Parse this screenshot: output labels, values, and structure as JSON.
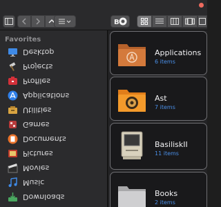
{
  "window": {
    "traffic_lights": [
      "#ec6a5e",
      "#f4bf4f",
      "#61c554"
    ],
    "accent": "#4a8fe8"
  },
  "toolbar": {
    "back_icon": "chevron-left-icon",
    "forward_icon": "chevron-right-icon",
    "up_icon": "chevron-up-icon",
    "action_icon": "list-action-icon",
    "tag_button_label": "B",
    "views": [
      "icon-view",
      "list-view",
      "column-view",
      "gallery-view"
    ],
    "selected_view": "icon-view"
  },
  "sidebar": {
    "header": "Favorites",
    "items": [
      {
        "label": "Desktop",
        "icon": "desktop-icon"
      },
      {
        "label": "Projects",
        "icon": "projects-icon"
      },
      {
        "label": "Profiles",
        "icon": "profiles-icon"
      },
      {
        "label": "Applications",
        "icon": "applications-icon"
      },
      {
        "label": "Utilities",
        "icon": "utilities-icon"
      },
      {
        "label": "Games",
        "icon": "games-icon"
      },
      {
        "label": "Documents",
        "icon": "documents-icon"
      },
      {
        "label": "Pictures",
        "icon": "pictures-icon"
      },
      {
        "label": "Movies",
        "icon": "movies-icon"
      },
      {
        "label": "Music",
        "icon": "music-icon"
      },
      {
        "label": "Downloads",
        "icon": "downloads-icon"
      }
    ]
  },
  "folders": [
    {
      "name": "Applications",
      "count": "6 items",
      "icon": "applications-folder-icon"
    },
    {
      "name": "Ast",
      "count": "7 items",
      "icon": "ast-folder-icon"
    },
    {
      "name": "BasiliskII",
      "count": "11 items",
      "icon": "basiliskii-folder-icon"
    },
    {
      "name": "Books",
      "count": "2 items",
      "icon": "books-folder-icon"
    }
  ]
}
